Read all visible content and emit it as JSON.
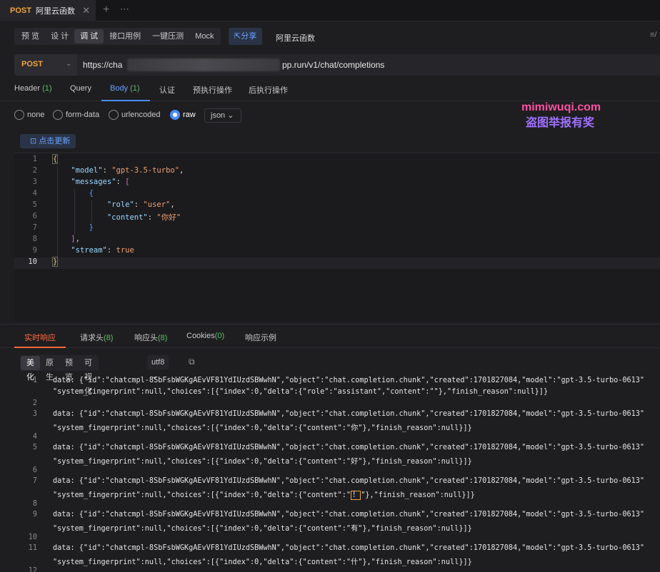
{
  "tab": {
    "method": "POST",
    "title": "阿里云函数",
    "close": "✕",
    "plus": "+",
    "more": "⋯"
  },
  "modes": [
    {
      "label": "预 览"
    },
    {
      "label": "设 计"
    },
    {
      "label": "调 试",
      "active": true
    },
    {
      "label": "接口用例"
    },
    {
      "label": "一键压测"
    },
    {
      "label": "Mock"
    }
  ],
  "share_label": "⇱分享",
  "function_label": "阿里云函数",
  "right_icon": "≡/",
  "url": {
    "method": "POST",
    "prefix": "https://cha",
    "suffix": "pp.run/v1/chat/completions",
    "chevron": "⌄"
  },
  "req_tabs": {
    "header": "Header",
    "header_count": "(1)",
    "query": "Query",
    "body": "Body",
    "body_count": "(1)",
    "auth": "认证",
    "pre": "预执行操作",
    "post": "后执行操作"
  },
  "body_types": [
    "none",
    "form-data",
    "urlencoded",
    "raw"
  ],
  "body_format": "json ⌄",
  "watermark": {
    "line1": "mimiwuqi.com",
    "line2": "盗图举报有奖"
  },
  "update_button": "⊡ 点击更新",
  "editor_lines": [
    "1",
    "2",
    "3",
    "4",
    "5",
    "6",
    "7",
    "8",
    "9",
    "10"
  ],
  "editor": {
    "l1": "{",
    "l2_key": "\"model\"",
    "l2_val": "\"gpt-3.5-turbo\"",
    "l3_key": "\"messages\"",
    "l3_br": "[",
    "l4": "{",
    "l5_key": "\"role\"",
    "l5_val": "\"user\"",
    "l6_key": "\"content\"",
    "l6_val": "\"你好\"",
    "l7": "}",
    "l8": "]",
    "l9_key": "\"stream\"",
    "l9_val": "true",
    "l10": "}"
  },
  "resp_tabs": {
    "live": "实时响应",
    "req_head": "请求头",
    "req_head_cnt": "(8)",
    "resp_head": "响应头",
    "resp_head_cnt": "(8)",
    "cookies": "Cookies",
    "cookies_cnt": "(0)",
    "example": "响应示例"
  },
  "view_modes": [
    {
      "label": "美化",
      "active": true
    },
    {
      "label": "原生"
    },
    {
      "label": "预览"
    },
    {
      "label": "可视化"
    }
  ],
  "encoding": "utf8 ⌄",
  "copy_icon": "⧉",
  "response": {
    "nums": [
      "1",
      "2",
      "3",
      "4",
      "5",
      "6",
      "7",
      "8",
      "9",
      "10",
      "11",
      "12"
    ],
    "prefix": "data: {\"id\":\"chatcmpl-8SbFsbWGKgAEvVF81YdIUzdSBWwhN\",\"object\":\"chat.completion.chunk\",\"created\":1701827084,\"model\":\"gpt-3.5-turbo-0613\"",
    "c1": "\"system_fingerprint\":null,\"choices\":[{\"index\":0,\"delta\":{\"role\":\"assistant\",\"content\":\"\"},\"finish_reason\":null}]}",
    "c3": "\"system_fingerprint\":null,\"choices\":[{\"index\":0,\"delta\":{\"content\":\"你\"},\"finish_reason\":null}]}",
    "c5": "\"system_fingerprint\":null,\"choices\":[{\"index\":0,\"delta\":{\"content\":\"好\"},\"finish_reason\":null}]}",
    "c7a": "\"system_fingerprint\":null,\"choices\":[{\"index\":0,\"delta\":{\"content\":\"",
    "c7b": "！",
    "c7c": "\"},\"finish_reason\":null}]}",
    "c9": "\"system_fingerprint\":null,\"choices\":[{\"index\":0,\"delta\":{\"content\":\"有\"},\"finish_reason\":null}]}",
    "c11": "\"system_fingerprint\":null,\"choices\":[{\"index\":0,\"delta\":{\"content\":\"什\"},\"finish_reason\":null}]}"
  }
}
